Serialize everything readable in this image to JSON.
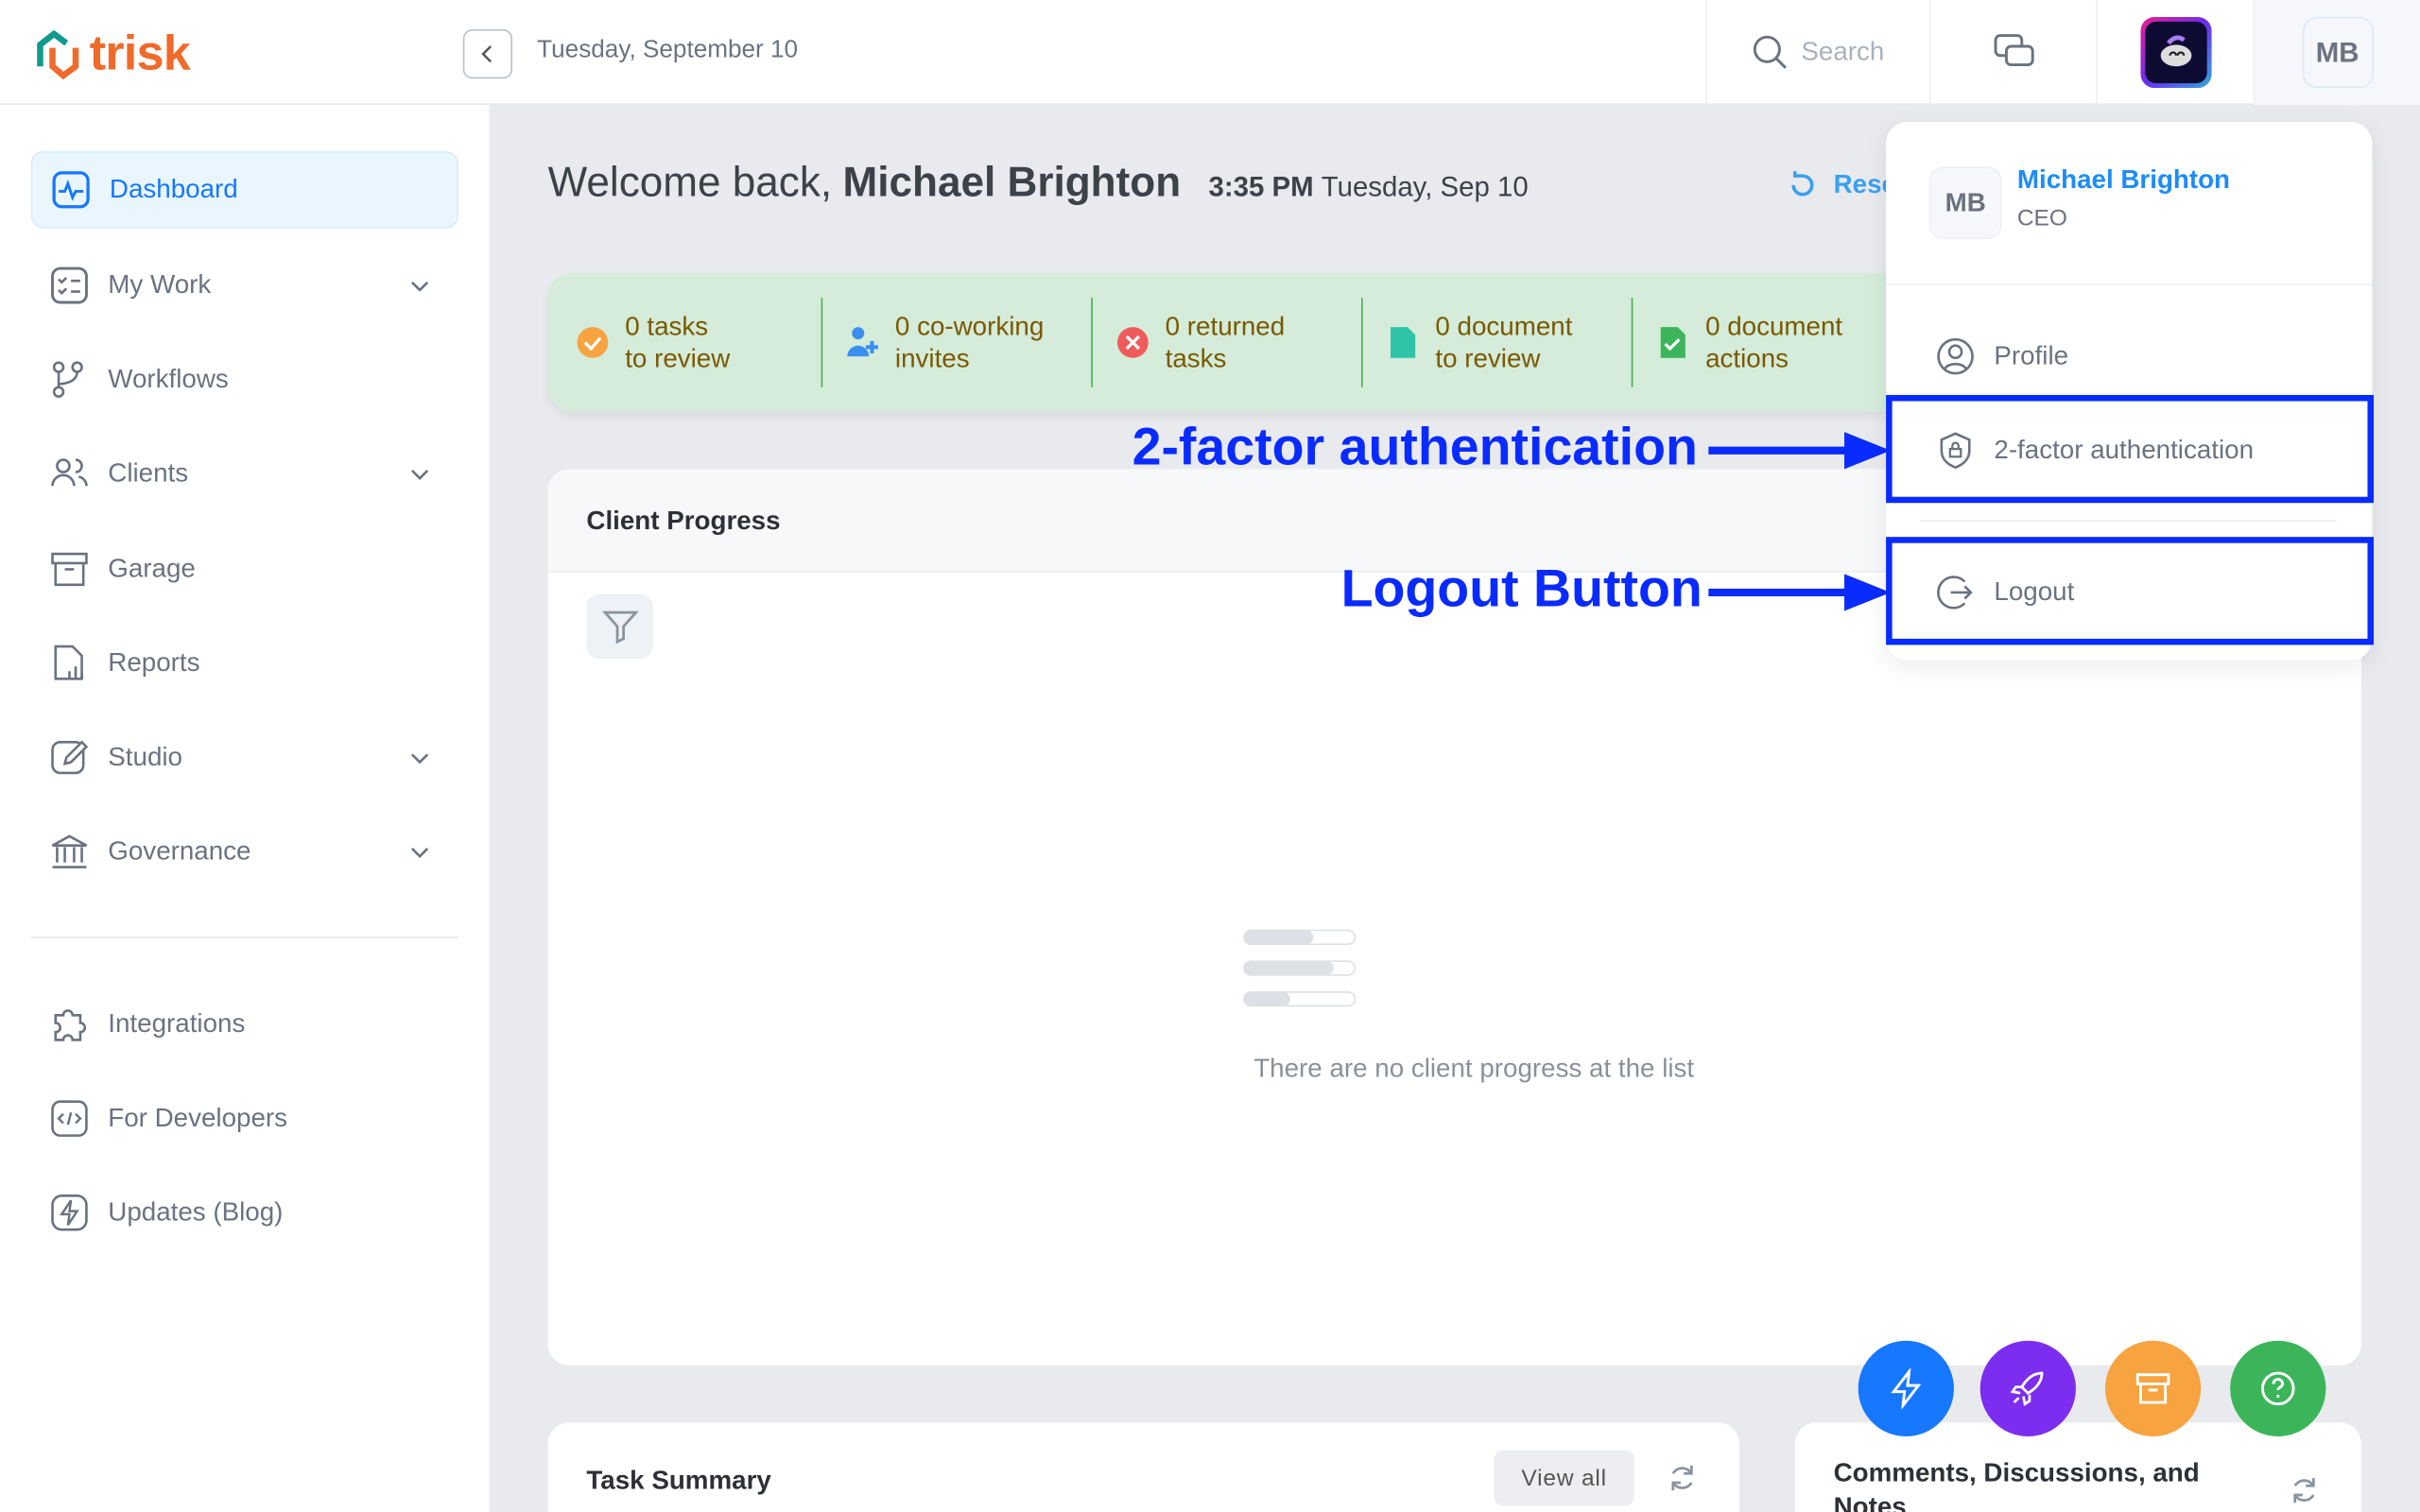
{
  "app": {
    "logo_text": "trisk",
    "date": "Tuesday, September 10"
  },
  "topbar": {
    "search_placeholder": "Search",
    "avatar_initials": "MB"
  },
  "sidebar": {
    "items": [
      {
        "label": "Dashboard",
        "icon": "dashboard-icon",
        "active": true
      },
      {
        "label": "My Work",
        "icon": "checklist-icon",
        "expandable": true
      },
      {
        "label": "Workflows",
        "icon": "workflow-icon"
      },
      {
        "label": "Clients",
        "icon": "users-icon",
        "expandable": true
      },
      {
        "label": "Garage",
        "icon": "archive-icon"
      },
      {
        "label": "Reports",
        "icon": "report-icon"
      },
      {
        "label": "Studio",
        "icon": "pen-icon",
        "expandable": true
      },
      {
        "label": "Governance",
        "icon": "bank-icon",
        "expandable": true
      },
      {
        "label": "Integrations",
        "icon": "puzzle-icon"
      },
      {
        "label": "For Developers",
        "icon": "code-icon"
      },
      {
        "label": "Updates (Blog)",
        "icon": "bolt-icon"
      }
    ]
  },
  "main": {
    "welcome_prefix": "Welcome back,",
    "user_name": "Michael Brighton",
    "time": "3:35 PM",
    "date_short": "Tuesday, Sep 10",
    "reset_label": "Rese",
    "stats": [
      {
        "line1": "0 tasks",
        "line2": "to review"
      },
      {
        "line1": "0 co-working",
        "line2": "invites"
      },
      {
        "line1": "0 returned",
        "line2": "tasks"
      },
      {
        "line1": "0 document",
        "line2": "to review"
      },
      {
        "line1": "0 document",
        "line2": "actions"
      }
    ],
    "client_progress": {
      "title": "Client Progress",
      "empty_text": "There are no client progress at the list"
    },
    "task_summary": {
      "title": "Task Summary",
      "view_all": "View all"
    },
    "comments": {
      "title": "Comments, Discussions, and Notes"
    }
  },
  "dropdown": {
    "initials": "MB",
    "name": "Michael Brighton",
    "role": "CEO",
    "items": [
      "Profile",
      "2-factor authentication",
      "Logout"
    ]
  },
  "annotations": {
    "twofa": "2-factor authentication",
    "logout": "Logout Button"
  },
  "colors": {
    "accent": "#1677ff",
    "stats_bg": "#d4ecd9",
    "annotation": "#0a2bff",
    "fab_blue": "#1677ff",
    "fab_purple": "#7c2df0",
    "fab_orange": "#f7a340",
    "fab_green": "#3cb55a"
  }
}
